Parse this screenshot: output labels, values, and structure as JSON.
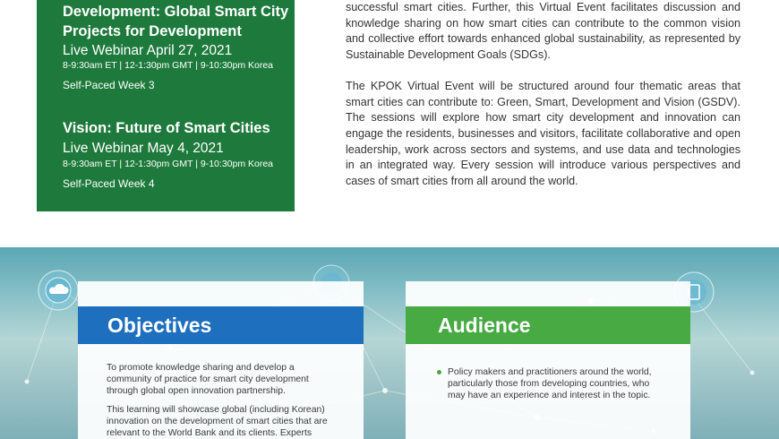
{
  "schedule": {
    "session3_title": "Development: Global Smart City Projects for Development",
    "session3_live": "Live Webinar April 27, 2021",
    "session3_times": "8-9:30am ET | 12-1:30pm GMT | 9-10:30pm Korea",
    "session3_self_paced": "Self-Paced Week 3",
    "session4_title": "Vision: Future of Smart Cities",
    "session4_live": "Live Webinar May 4, 2021",
    "session4_times": "8-9:30am ET | 12-1:30pm GMT | 9-10:30pm Korea",
    "session4_self_paced": "Self-Paced Week 4"
  },
  "intro": {
    "paragraph1": "successful smart cities. Further, this Virtual Event facilitates discussion and knowledge sharing on how smart cities can contribute to the common vision and collective effort towards enhanced global sustainability, as represented by Sustainable Development Goals (SDGs).",
    "paragraph2": "The KPOK Virtual Event will be structured around four thematic areas that smart cities can contribute to: Green, Smart, Development and Vision (GSDV). The sessions will explore how smart city development and innovation can engage the residents, businesses and visitors, facilitate collaborative and open leadership, work across sectors and systems, and use data and technologies in an integrated way. Every session will introduce various perspectives and cases of smart cities from all around the world."
  },
  "objectives": {
    "heading": "Objectives",
    "paragraph1": "To promote knowledge sharing and develop a community of practice for smart city development through global open innovation partnership.",
    "paragraph2": "This learning will showcase global (including Korean) innovation on the development of smart cities that are relevant to the World Bank and its clients. Experts"
  },
  "audience": {
    "heading": "Audience",
    "bullet1": "Policy makers and practitioners around the world, particularly those from developing countries, who may have an experience and interest in the topic."
  },
  "colors": {
    "session_box": "#1e7a3c",
    "objectives_banner": "#1e6fbe",
    "audience_banner": "#47aa42"
  }
}
